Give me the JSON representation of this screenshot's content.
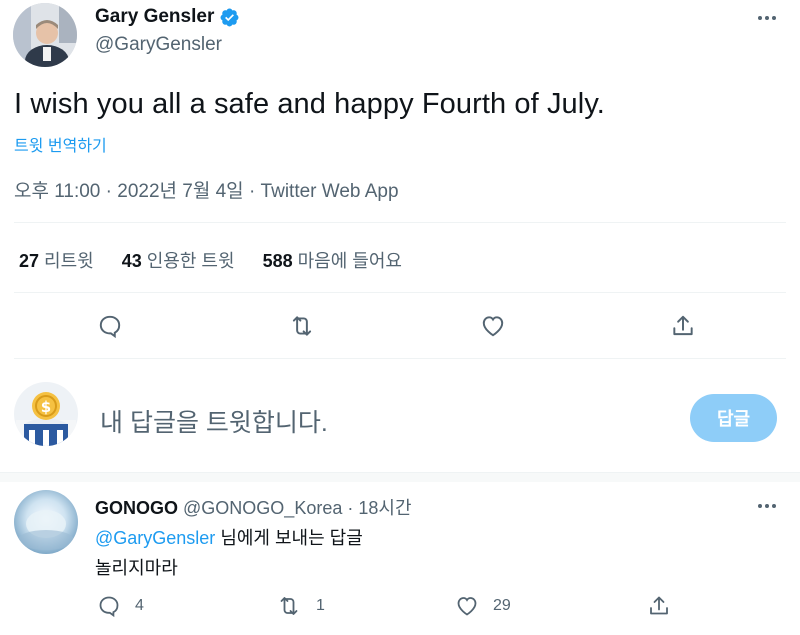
{
  "tweet": {
    "display_name": "Gary Gensler",
    "handle": "@GaryGensler",
    "text": "I wish you all a safe and happy Fourth of July.",
    "translate_link": "트윗 번역하기",
    "meta": "오후 11:00 · 2022년 7월 4일 · Twitter Web App",
    "stats": [
      {
        "count": "27",
        "label": "리트윗"
      },
      {
        "count": "43",
        "label": "인용한 트윗"
      },
      {
        "count": "588",
        "label": "마음에 들어요"
      }
    ],
    "icons": {
      "verified": "verified-badge-icon",
      "more": "more-icon",
      "reply": "reply-icon",
      "retweet": "retweet-icon",
      "like": "heart-icon",
      "share": "share-icon"
    }
  },
  "reply_box": {
    "placeholder": "내 답글을 트윗합니다.",
    "button_label": "답글"
  },
  "reply": {
    "display_name": "GONOGO",
    "handle": "@GONOGO_Korea",
    "time": "· 18시간",
    "mention": "@GaryGensler",
    "line1_rest": " 님에게 보내는 답글",
    "line2": "놀리지마라",
    "reply_count": "4",
    "retweet_count": "1",
    "like_count": "29"
  },
  "colors": {
    "accent": "#1d9bf0",
    "text_primary": "#0f1419",
    "text_secondary": "#536471",
    "reply_button_disabled": "#8ecdf8"
  }
}
